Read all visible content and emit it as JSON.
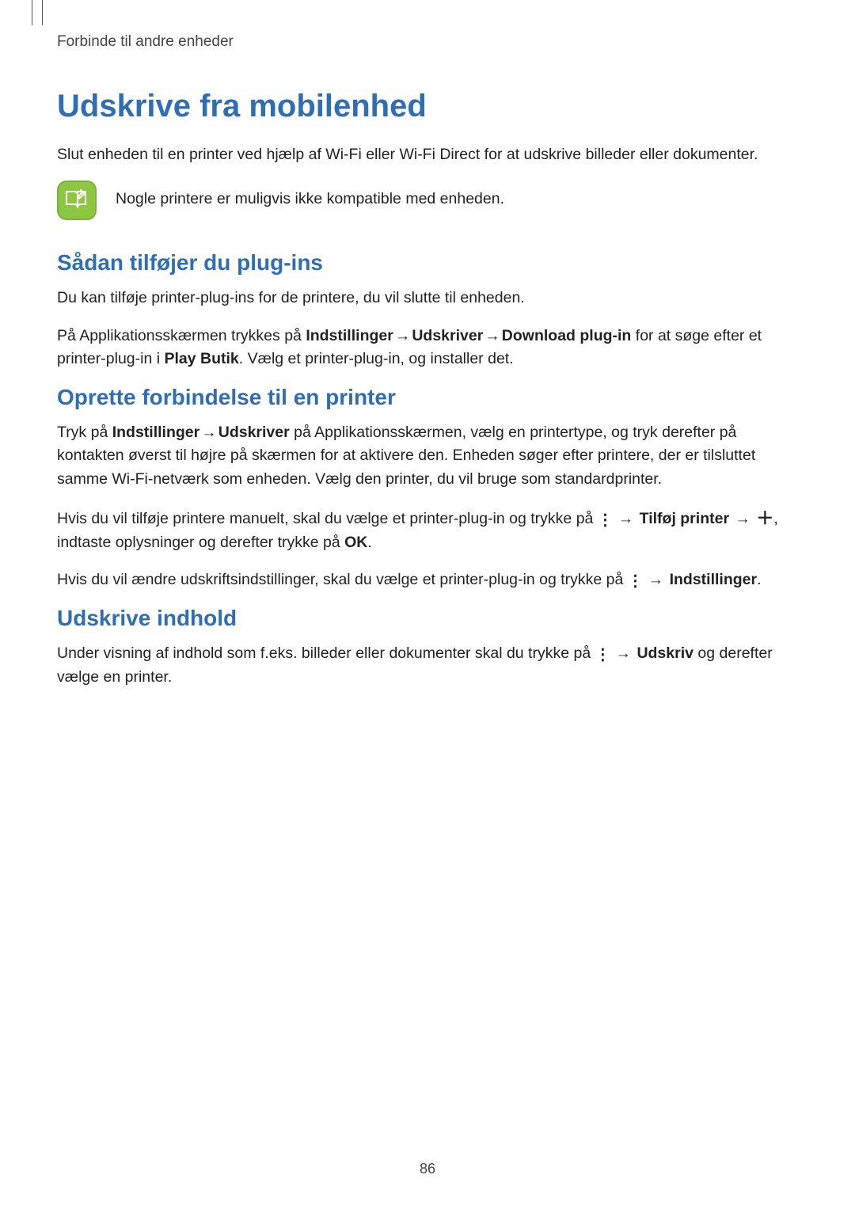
{
  "header": {
    "running": "Forbinde til andre enheder"
  },
  "title": "Udskrive fra mobilenhed",
  "intro": "Slut enheden til en printer ved hjælp af Wi-Fi eller Wi-Fi Direct for at udskrive billeder eller dokumenter.",
  "note": "Nogle printere er muligvis ikke kompatible med enheden.",
  "section1": {
    "heading": "Sådan tilføjer du plug-ins",
    "p1": "Du kan tilføje printer-plug-ins for de printere, du vil slutte til enheden.",
    "p2_a": "På Applikationsskærmen trykkes på ",
    "p2_b1": "Indstillinger",
    "p2_arrow": " → ",
    "p2_b2": "Udskriver",
    "p2_b3": "Download plug-in",
    "p2_c": " for at søge efter et printer-plug-in i ",
    "p2_b4": "Play Butik",
    "p2_d": ". Vælg et printer-plug-in, og installer det."
  },
  "section2": {
    "heading": "Oprette forbindelse til en printer",
    "p1_a": "Tryk på ",
    "p1_b1": "Indstillinger",
    "p1_arrow": " → ",
    "p1_b2": "Udskriver",
    "p1_c": " på Applikationsskærmen, vælg en printertype, og tryk derefter på kontakten øverst til højre på skærmen for at aktivere den. Enheden søger efter printere, der er tilsluttet samme Wi-Fi-netværk som enheden. Vælg den printer, du vil bruge som standardprinter.",
    "p2_a": "Hvis du vil tilføje printere manuelt, skal du vælge et printer-plug-in og trykke på ",
    "p2_b1": "Tilføj printer",
    "p2_c": ", indtaste oplysninger og derefter trykke på ",
    "p2_b2": "OK",
    "p2_d": ".",
    "p3_a": "Hvis du vil ændre udskriftsindstillinger, skal du vælge et printer-plug-in og trykke på ",
    "p3_b1": "Indstillinger",
    "p3_c": "."
  },
  "section3": {
    "heading": "Udskrive indhold",
    "p1_a": "Under visning af indhold som f.eks. billeder eller dokumenter skal du trykke på ",
    "p1_b1": "Udskriv",
    "p1_c": " og derefter vælge en printer."
  },
  "pageNumber": "86",
  "glyphs": {
    "more": "⋮",
    "arrow": "→",
    "plus": "＋"
  }
}
